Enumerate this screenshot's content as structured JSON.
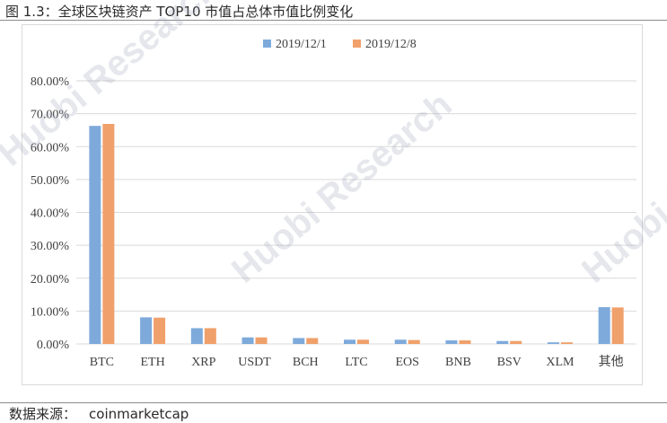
{
  "figure_title": "图 1.3：全球区块链资产 TOP10 市值占总体市值比例变化",
  "source_label": "数据来源：",
  "source_value": "coinmarketcap",
  "watermark_text": "Huobi Research",
  "colors": {
    "series1": "#7eaadb",
    "series2": "#f0a06a",
    "grid": "#d9d9d9",
    "text": "#404040"
  },
  "chart_data": {
    "type": "bar",
    "categories": [
      "BTC",
      "ETH",
      "XRP",
      "USDT",
      "BCH",
      "LTC",
      "EOS",
      "BNB",
      "BSV",
      "XLM",
      "其他"
    ],
    "series": [
      {
        "name": "2019/12/1",
        "values": [
          66.3,
          8.1,
          4.8,
          2.0,
          1.8,
          1.3,
          1.3,
          1.1,
          0.9,
          0.5,
          11.2
        ]
      },
      {
        "name": "2019/12/8",
        "values": [
          66.9,
          8.0,
          4.8,
          2.0,
          1.8,
          1.3,
          1.2,
          1.1,
          0.9,
          0.5,
          11.1
        ]
      }
    ],
    "yticks": [
      "0.00%",
      "10.00%",
      "20.00%",
      "30.00%",
      "40.00%",
      "50.00%",
      "60.00%",
      "70.00%",
      "80.00%"
    ],
    "ylim": [
      0,
      80
    ],
    "legend_position": "top-center",
    "grid": true
  }
}
